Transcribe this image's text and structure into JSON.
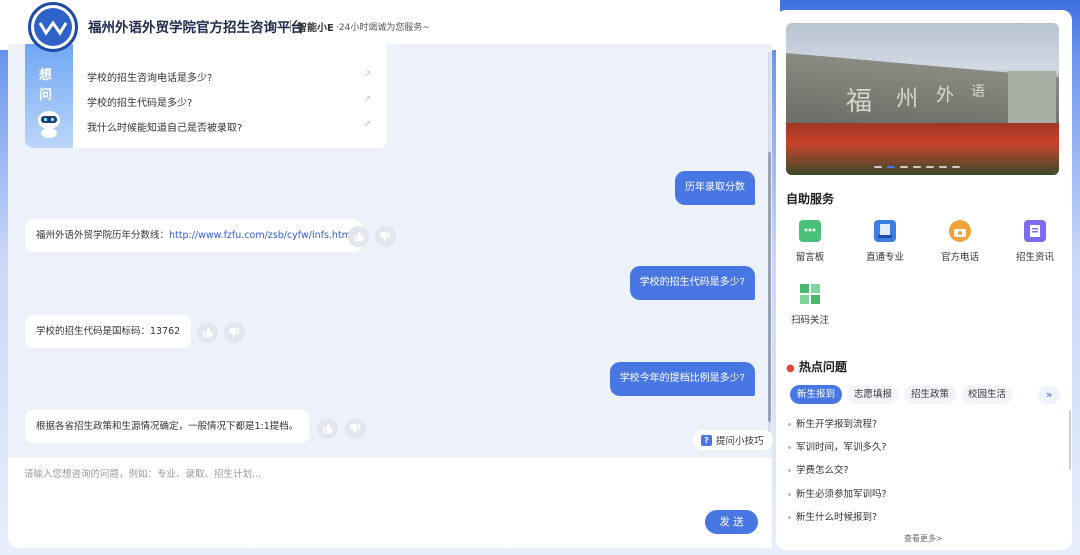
{
  "header": {
    "title": "福州外语外贸学院官方招生咨询平台",
    "assistant_name": "智能小E",
    "slogan": "·24小时竭诚为您服务~"
  },
  "suggest": {
    "banner_chars": [
      "想",
      "问"
    ],
    "items": [
      "学校的招生咨询电话是多少?",
      "学校的招生代码是多少?",
      "我什么时候能知道自己是否被录取?"
    ]
  },
  "messages": [
    {
      "role": "user",
      "text": "历年录取分数"
    },
    {
      "role": "bot",
      "prefix": "福州外语外贸学院历年分数线：",
      "link": "http://www.fzfu.com/zsb/cyfw/lnfs.htm"
    },
    {
      "role": "user",
      "text": "学校的招生代码是多少?"
    },
    {
      "role": "bot",
      "text": "学校的招生代码是国标码：13762"
    },
    {
      "role": "user",
      "text": "学校今年的提档比例是多少?"
    },
    {
      "role": "bot",
      "text": "根据各省招生政策和生源情况确定，一般情况下都是1:1提档。"
    }
  ],
  "tips_label": "提问小技巧",
  "input": {
    "placeholder": "请输入您想咨询的问题，例如：专业、录取、招生计划...",
    "value": ""
  },
  "send_label": "发 送",
  "self_service": {
    "title": "自助服务",
    "items": [
      {
        "label": "留言板",
        "icon": "message-board-icon",
        "color": "#4bc07a"
      },
      {
        "label": "直通专业",
        "icon": "book-icon",
        "color": "#3d7fe0"
      },
      {
        "label": "官方电话",
        "icon": "phone-icon",
        "color": "#f0a43a"
      },
      {
        "label": "招生资讯",
        "icon": "document-icon",
        "color": "#7b6cf0"
      },
      {
        "label": "扫码关注",
        "icon": "qrcode-icon",
        "color": "#49b86f"
      }
    ]
  },
  "hot": {
    "title": "热点问题",
    "tabs": [
      "新生报到",
      "志愿填报",
      "招生政策",
      "校园生活"
    ],
    "active_tab": 0,
    "items": [
      "新生开学报到流程?",
      "军训时间，军训多久?",
      "学费怎么交?",
      "新生必须参加军训吗?",
      "新生什么时候报到?"
    ],
    "see_more": "查看更多>"
  },
  "colors": {
    "accent": "#4876e3",
    "background": "#edf1f9"
  }
}
